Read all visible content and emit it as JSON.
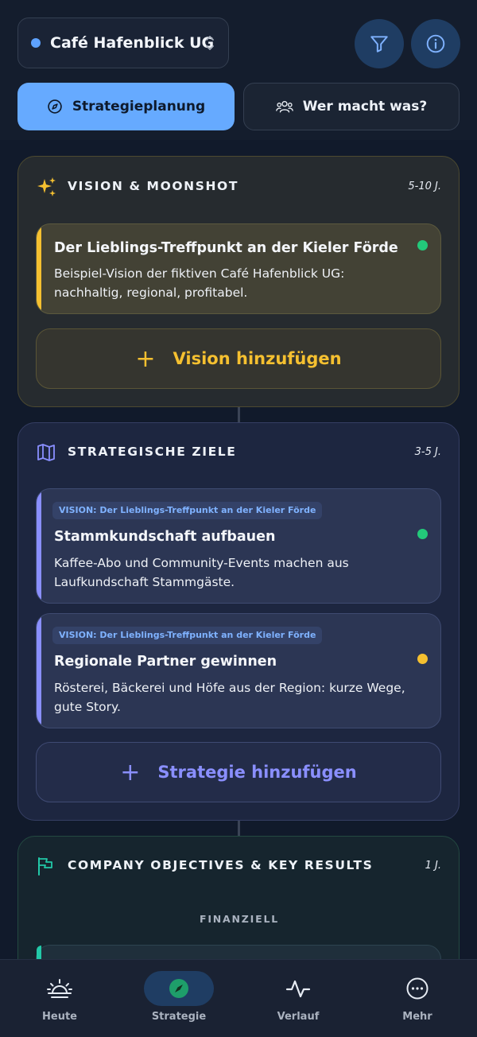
{
  "header": {
    "company_name": "Café Hafenblick UG",
    "tabs": [
      {
        "label": "Strategieplanung",
        "icon": "compass-icon",
        "active": true
      },
      {
        "label": "Wer macht was?",
        "icon": "users-icon",
        "active": false
      }
    ],
    "filter_icon": "filter-icon",
    "info_icon": "info-icon"
  },
  "sections": {
    "vision": {
      "title": "VISION & MOONSHOT",
      "horizon": "5-10 J.",
      "icon": "sparkles-icon",
      "cards": [
        {
          "title": "Der Lieblings-Treffpunkt an der Kieler Förde",
          "description": "Beispiel-Vision der fiktiven Café Hafenblick UG: nachhaltig, regional, profitabel.",
          "status_color": "#23c97a"
        }
      ],
      "add_label": "Vision hinzufügen"
    },
    "strategy": {
      "title": "STRATEGISCHE ZIELE",
      "horizon": "3-5 J.",
      "icon": "map-icon",
      "cards": [
        {
          "tag": "VISION: Der Lieblings-Treffpunkt an der Kieler Förde",
          "title": "Stammkundschaft aufbauen",
          "description": "Kaffee-Abo und Community-Events machen aus Laufkundschaft Stammgäste.",
          "status_color": "#23c97a"
        },
        {
          "tag": "VISION: Der Lieblings-Treffpunkt an der Kieler Förde",
          "title": "Regionale Partner gewinnen",
          "description": "Rösterei, Bäckerei und Höfe aus der Region: kurze Wege, gute Story.",
          "status_color": "#f5c030"
        }
      ],
      "add_label": "Strategie hinzufügen"
    },
    "okr": {
      "title": "COMPANY OBJECTIVES & KEY RESULTS",
      "horizon": "1 J.",
      "icon": "flag-icon",
      "category": "FINANZIELL"
    }
  },
  "colors": {
    "accent_blue": "#66aaff",
    "vision_yellow": "#f5c030",
    "strategy_purple": "#8a8fff",
    "okr_teal": "#22c9a8"
  },
  "bottom_nav": [
    {
      "label": "Heute",
      "icon": "sunrise-icon",
      "active": false
    },
    {
      "label": "Strategie",
      "icon": "compass-icon",
      "active": true
    },
    {
      "label": "Verlauf",
      "icon": "activity-icon",
      "active": false
    },
    {
      "label": "Mehr",
      "icon": "more-icon",
      "active": false
    }
  ]
}
